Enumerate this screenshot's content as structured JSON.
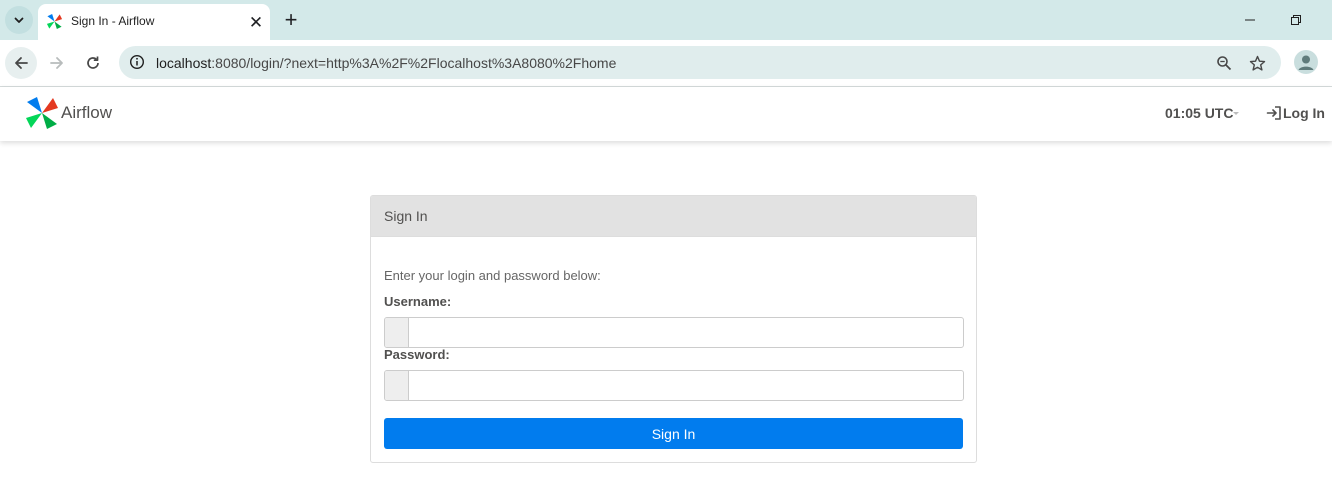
{
  "browser": {
    "tab": {
      "title": "Sign In - Airflow"
    },
    "address_bar": {
      "url_host": "localhost",
      "url_rest": ":8080/login/?next=http%3A%2F%2Flocalhost%3A8080%2Fhome"
    }
  },
  "navbar": {
    "brand": "Airflow",
    "clock": "01:05 UTC",
    "login_label": "Log In"
  },
  "signin_panel": {
    "title": "Sign In",
    "instructions": "Enter your login and password below:",
    "username_label": "Username:",
    "username_value": "",
    "password_label": "Password:",
    "password_value": "",
    "submit_label": "Sign In"
  },
  "colors": {
    "tabstrip": "#d3e9e9",
    "omnibox": "#e0eded",
    "panel_header": "#e2e2e2",
    "primary_button": "#017cee",
    "navbar_text": "#51504f"
  },
  "icons": [
    "tab-search-icon",
    "airflow-favicon-icon",
    "close-icon",
    "plus-icon",
    "minimize-icon",
    "restore-icon",
    "close-window-icon",
    "back-arrow-icon",
    "forward-arrow-icon",
    "reload-icon",
    "info-icon",
    "zoom-icon",
    "bookmark-star-icon",
    "profile-icon",
    "airflow-logo-icon",
    "login-icon"
  ]
}
